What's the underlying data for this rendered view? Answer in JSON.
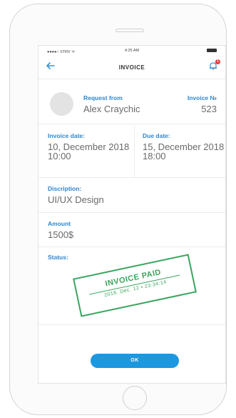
{
  "status_bar": {
    "carrier": "●●●●○ STRV ᯤ",
    "time": "4:25 AM"
  },
  "navbar": {
    "title": "INVOICE",
    "notification_count": "1"
  },
  "request": {
    "from_label": "Request from",
    "from_value": "Alex Craychic",
    "invoice_no_label": "Invoice №",
    "invoice_no_value": "523"
  },
  "dates": {
    "invoice_date_label": "Invoice date:",
    "invoice_date_value": "10, December 2018",
    "invoice_time_value": "10:00",
    "due_date_label": "Due date:",
    "due_date_value": "15, December 2018",
    "due_time_value": "18:00"
  },
  "description": {
    "label": "Discription:",
    "value": "UI/UX Design"
  },
  "amount": {
    "label": "Amount",
    "value": "1500$"
  },
  "status": {
    "label": "Status:",
    "stamp_title": "INVOICE PAID",
    "stamp_date": "2018. Dec. 12 • 23:34:14"
  },
  "actions": {
    "ok_label": "OK"
  },
  "colors": {
    "accent": "#2f86cf",
    "button": "#1c98e0",
    "stamp": "#3aa55e",
    "badge": "#e53935"
  }
}
